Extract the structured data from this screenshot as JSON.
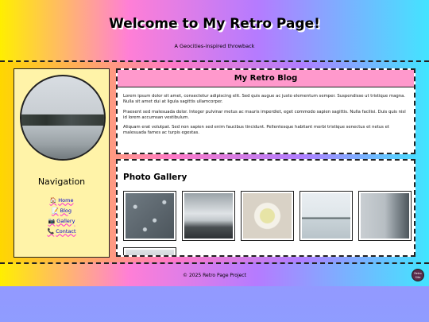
{
  "header": {
    "title": "Welcome to My Retro Page!",
    "subtitle": "A Geocities-inspired throwback"
  },
  "sidebar": {
    "nav_title": "Navigation",
    "items": [
      {
        "icon": "🏠",
        "icon_name": "home-icon",
        "label": "Home"
      },
      {
        "icon": "📝",
        "icon_name": "memo-icon",
        "label": "Blog"
      },
      {
        "icon": "📷",
        "icon_name": "camera-icon",
        "label": "Gallery"
      },
      {
        "icon": "📞",
        "icon_name": "phone-icon",
        "label": "Contact"
      }
    ]
  },
  "blog": {
    "title": "My Retro Blog",
    "paragraphs": [
      "Lorem ipsum dolor sit amet, consectetur adipiscing elit. Sed quis augue ac justo elementum semper. Suspendisse ut tristique magna. Nulla sit amet dui at ligula sagittis ullamcorper.",
      "Praesent sed malesuada dolor. Integer pulvinar metus ac mauris imperdiet, eget commodo sapien sagittis. Nulla facilisi. Duis quis nisl id lorem accumsan vestibulum.",
      "Aliquam erat volutpat. Sed non sapien sed enim faucibus tincidunt. Pellentesque habitant morbi tristique senectus et netus et malesuada fames ac turpis egestas."
    ]
  },
  "gallery": {
    "title": "Photo Gallery",
    "photos": [
      {
        "name": "water-droplets-photo"
      },
      {
        "name": "person-over-clouds-photo"
      },
      {
        "name": "cup-of-tea-photo"
      },
      {
        "name": "island-in-lake-photo"
      },
      {
        "name": "person-by-sea-photo"
      },
      {
        "name": "partial-photo"
      }
    ]
  },
  "footer": {
    "copyright": "© 2025 Retro Page Project",
    "badge": "Retro Site"
  },
  "colors": {
    "blog_header": "#ff99cc",
    "sidebar_bg": "#fff3a8",
    "link": "#0000cc"
  }
}
